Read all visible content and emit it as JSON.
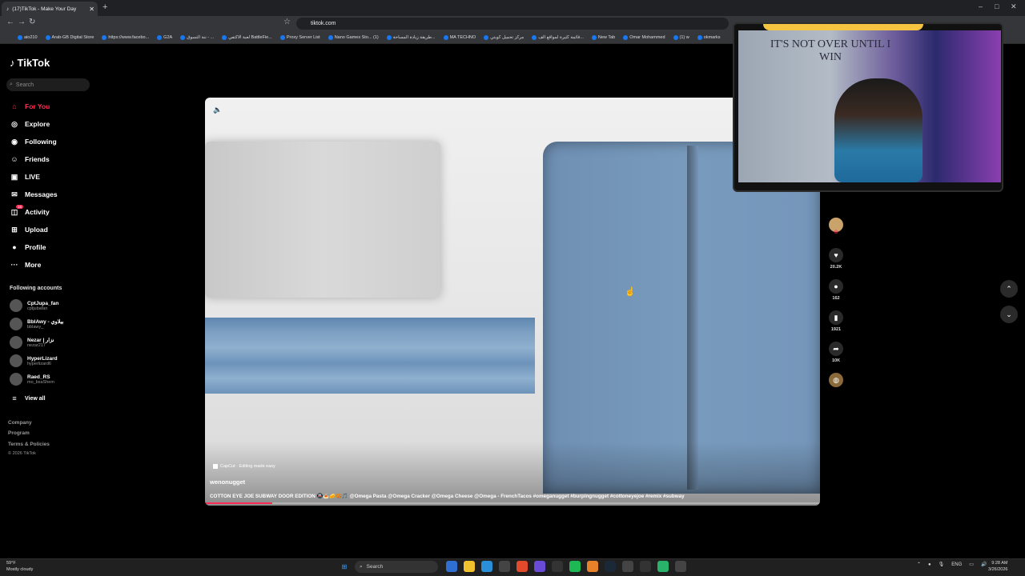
{
  "browser": {
    "tab_title": "(17)TikTok - Make Your Day",
    "new_tab_symbol": "+",
    "url": "tiktok.com",
    "bookmarks": [
      "aio210",
      "Arab-GB Digital Store",
      "https://www.facebo...",
      "G2A",
      "ننة التسوق - ...",
      "لعبة الاكتفي BattleFie...",
      "Proxy Server List",
      "Nano Games Sto... (1)",
      "طريقة زيادة المساحة...",
      "MA TECHNO",
      "مركز تحميل كوبتي",
      "قائمة كثيرة لمواقع الف...",
      "New Tab",
      "Omar Mohammed",
      "(1) w",
      "okmarks"
    ]
  },
  "sidebar": {
    "logo": "TikTok",
    "search_placeholder": "Search",
    "nav": [
      {
        "label": "For You",
        "icon": "home-icon",
        "active": true
      },
      {
        "label": "Explore",
        "icon": "compass-icon"
      },
      {
        "label": "Following",
        "icon": "following-icon"
      },
      {
        "label": "Friends",
        "icon": "friends-icon"
      },
      {
        "label": "LIVE",
        "icon": "live-icon"
      },
      {
        "label": "Messages",
        "icon": "messages-icon"
      },
      {
        "label": "Activity",
        "icon": "activity-icon",
        "badge": "16"
      },
      {
        "label": "Upload",
        "icon": "upload-icon"
      },
      {
        "label": "Profile",
        "icon": "profile-icon"
      },
      {
        "label": "More",
        "icon": "more-icon"
      }
    ],
    "following_header": "Following accounts",
    "accounts": [
      {
        "name": "CptJupa_fan",
        "handle": "cptjubafan"
      },
      {
        "name": "BblAwy - بيلاوي",
        "handle": "bblawy_"
      },
      {
        "name": "Nezar | نزار",
        "handle": "nezar217"
      },
      {
        "name": "HyperLizard",
        "handle": "hyperlizard6"
      },
      {
        "name": "Raed_RS",
        "handle": "mo_bxaShem"
      }
    ],
    "view_all": "View all",
    "footer": [
      "Company",
      "Program",
      "Terms & Policies",
      "© 2026 TikTok"
    ]
  },
  "video": {
    "capcut": "CapCut · Editing made easy",
    "author": "wenonugget",
    "caption": "COTTON EYE JOE SUBWAY DOOR EDITION 🚇🍝🧀🥨🎵 @Omega Pasta @Omega Cracker @Omega Cheese @Omega - FrenchTacos #omeganugget #burpingnugget #cottoneyejoe #remix #subway",
    "progress": 0.11
  },
  "actions": [
    {
      "name": "like",
      "icon": "heart-icon",
      "count": "20.2K"
    },
    {
      "name": "comment",
      "icon": "comment-icon",
      "count": "162"
    },
    {
      "name": "save",
      "icon": "bookmark-icon",
      "count": "1921"
    },
    {
      "name": "share",
      "icon": "share-icon",
      "count": "10K"
    }
  ],
  "webcam": {
    "flag_text": "IT'S NOT OVER UNTIL I WIN"
  },
  "taskbar": {
    "weather_temp": "59°F",
    "weather_desc": "Mostly cloudy",
    "search": "Search",
    "lang": "ENG",
    "time": "9:28 AM",
    "date": "3/26/2026"
  },
  "colors": {
    "accent": "#fe2c55",
    "background": "#000000"
  }
}
